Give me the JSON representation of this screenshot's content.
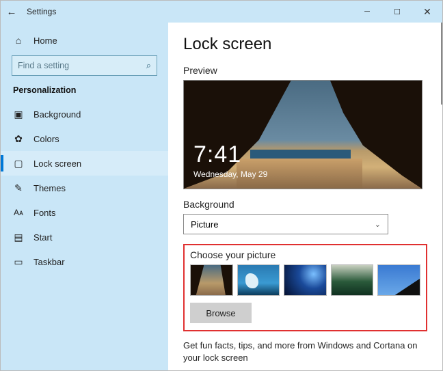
{
  "window": {
    "title": "Settings"
  },
  "sidebar": {
    "home": "Home",
    "search_placeholder": "Find a setting",
    "group": "Personalization",
    "items": [
      {
        "label": "Background"
      },
      {
        "label": "Colors"
      },
      {
        "label": "Lock screen"
      },
      {
        "label": "Themes"
      },
      {
        "label": "Fonts"
      },
      {
        "label": "Start"
      },
      {
        "label": "Taskbar"
      }
    ]
  },
  "main": {
    "title": "Lock screen",
    "preview_label": "Preview",
    "clock": {
      "time": "7:41",
      "date": "Wednesday, May 29"
    },
    "background_label": "Background",
    "background_value": "Picture",
    "choose_label": "Choose your picture",
    "browse_label": "Browse",
    "tip": "Get fun facts, tips, and more from Windows and Cortana on your lock screen"
  }
}
